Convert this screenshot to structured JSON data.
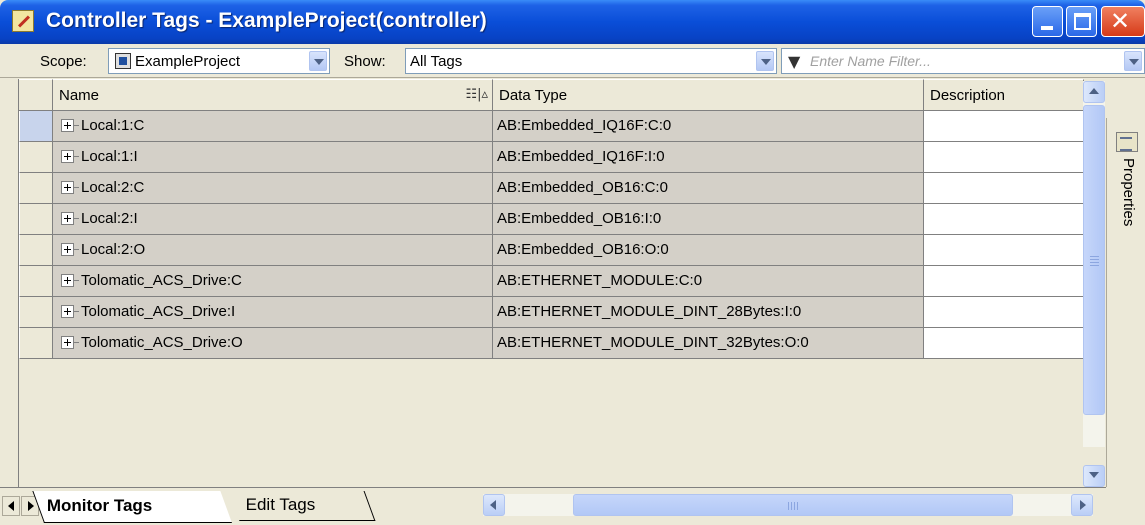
{
  "window": {
    "title": "Controller Tags - ExampleProject(controller)"
  },
  "toolbar": {
    "scope_label": "Scope:",
    "scope_value": "ExampleProject",
    "show_label": "Show:",
    "show_value": "All Tags",
    "filter_placeholder": "Enter Name Filter..."
  },
  "table": {
    "columns": [
      "Name",
      "Data Type",
      "Description"
    ],
    "rows": [
      {
        "name": "Local:1:C",
        "type": "AB:Embedded_IQ16F:C:0",
        "description": ""
      },
      {
        "name": "Local:1:I",
        "type": "AB:Embedded_IQ16F:I:0",
        "description": ""
      },
      {
        "name": "Local:2:C",
        "type": "AB:Embedded_OB16:C:0",
        "description": ""
      },
      {
        "name": "Local:2:I",
        "type": "AB:Embedded_OB16:I:0",
        "description": ""
      },
      {
        "name": "Local:2:O",
        "type": "AB:Embedded_OB16:O:0",
        "description": ""
      },
      {
        "name": "Tolomatic_ACS_Drive:C",
        "type": "AB:ETHERNET_MODULE:C:0",
        "description": ""
      },
      {
        "name": "Tolomatic_ACS_Drive:I",
        "type": "AB:ETHERNET_MODULE_DINT_28Bytes:I:0",
        "description": ""
      },
      {
        "name": "Tolomatic_ACS_Drive:O",
        "type": "AB:ETHERNET_MODULE_DINT_32Bytes:O:0",
        "description": ""
      }
    ]
  },
  "side_panel": {
    "label": "Properties"
  },
  "tabs": {
    "active": "Monitor Tags",
    "other": "Edit Tags"
  },
  "colors": {
    "titlebar": "#0A4ED8",
    "grid_cell": "#D4D0C8",
    "selected_row_header": "#C8D4EC",
    "window_bg": "#ECE9D8"
  }
}
